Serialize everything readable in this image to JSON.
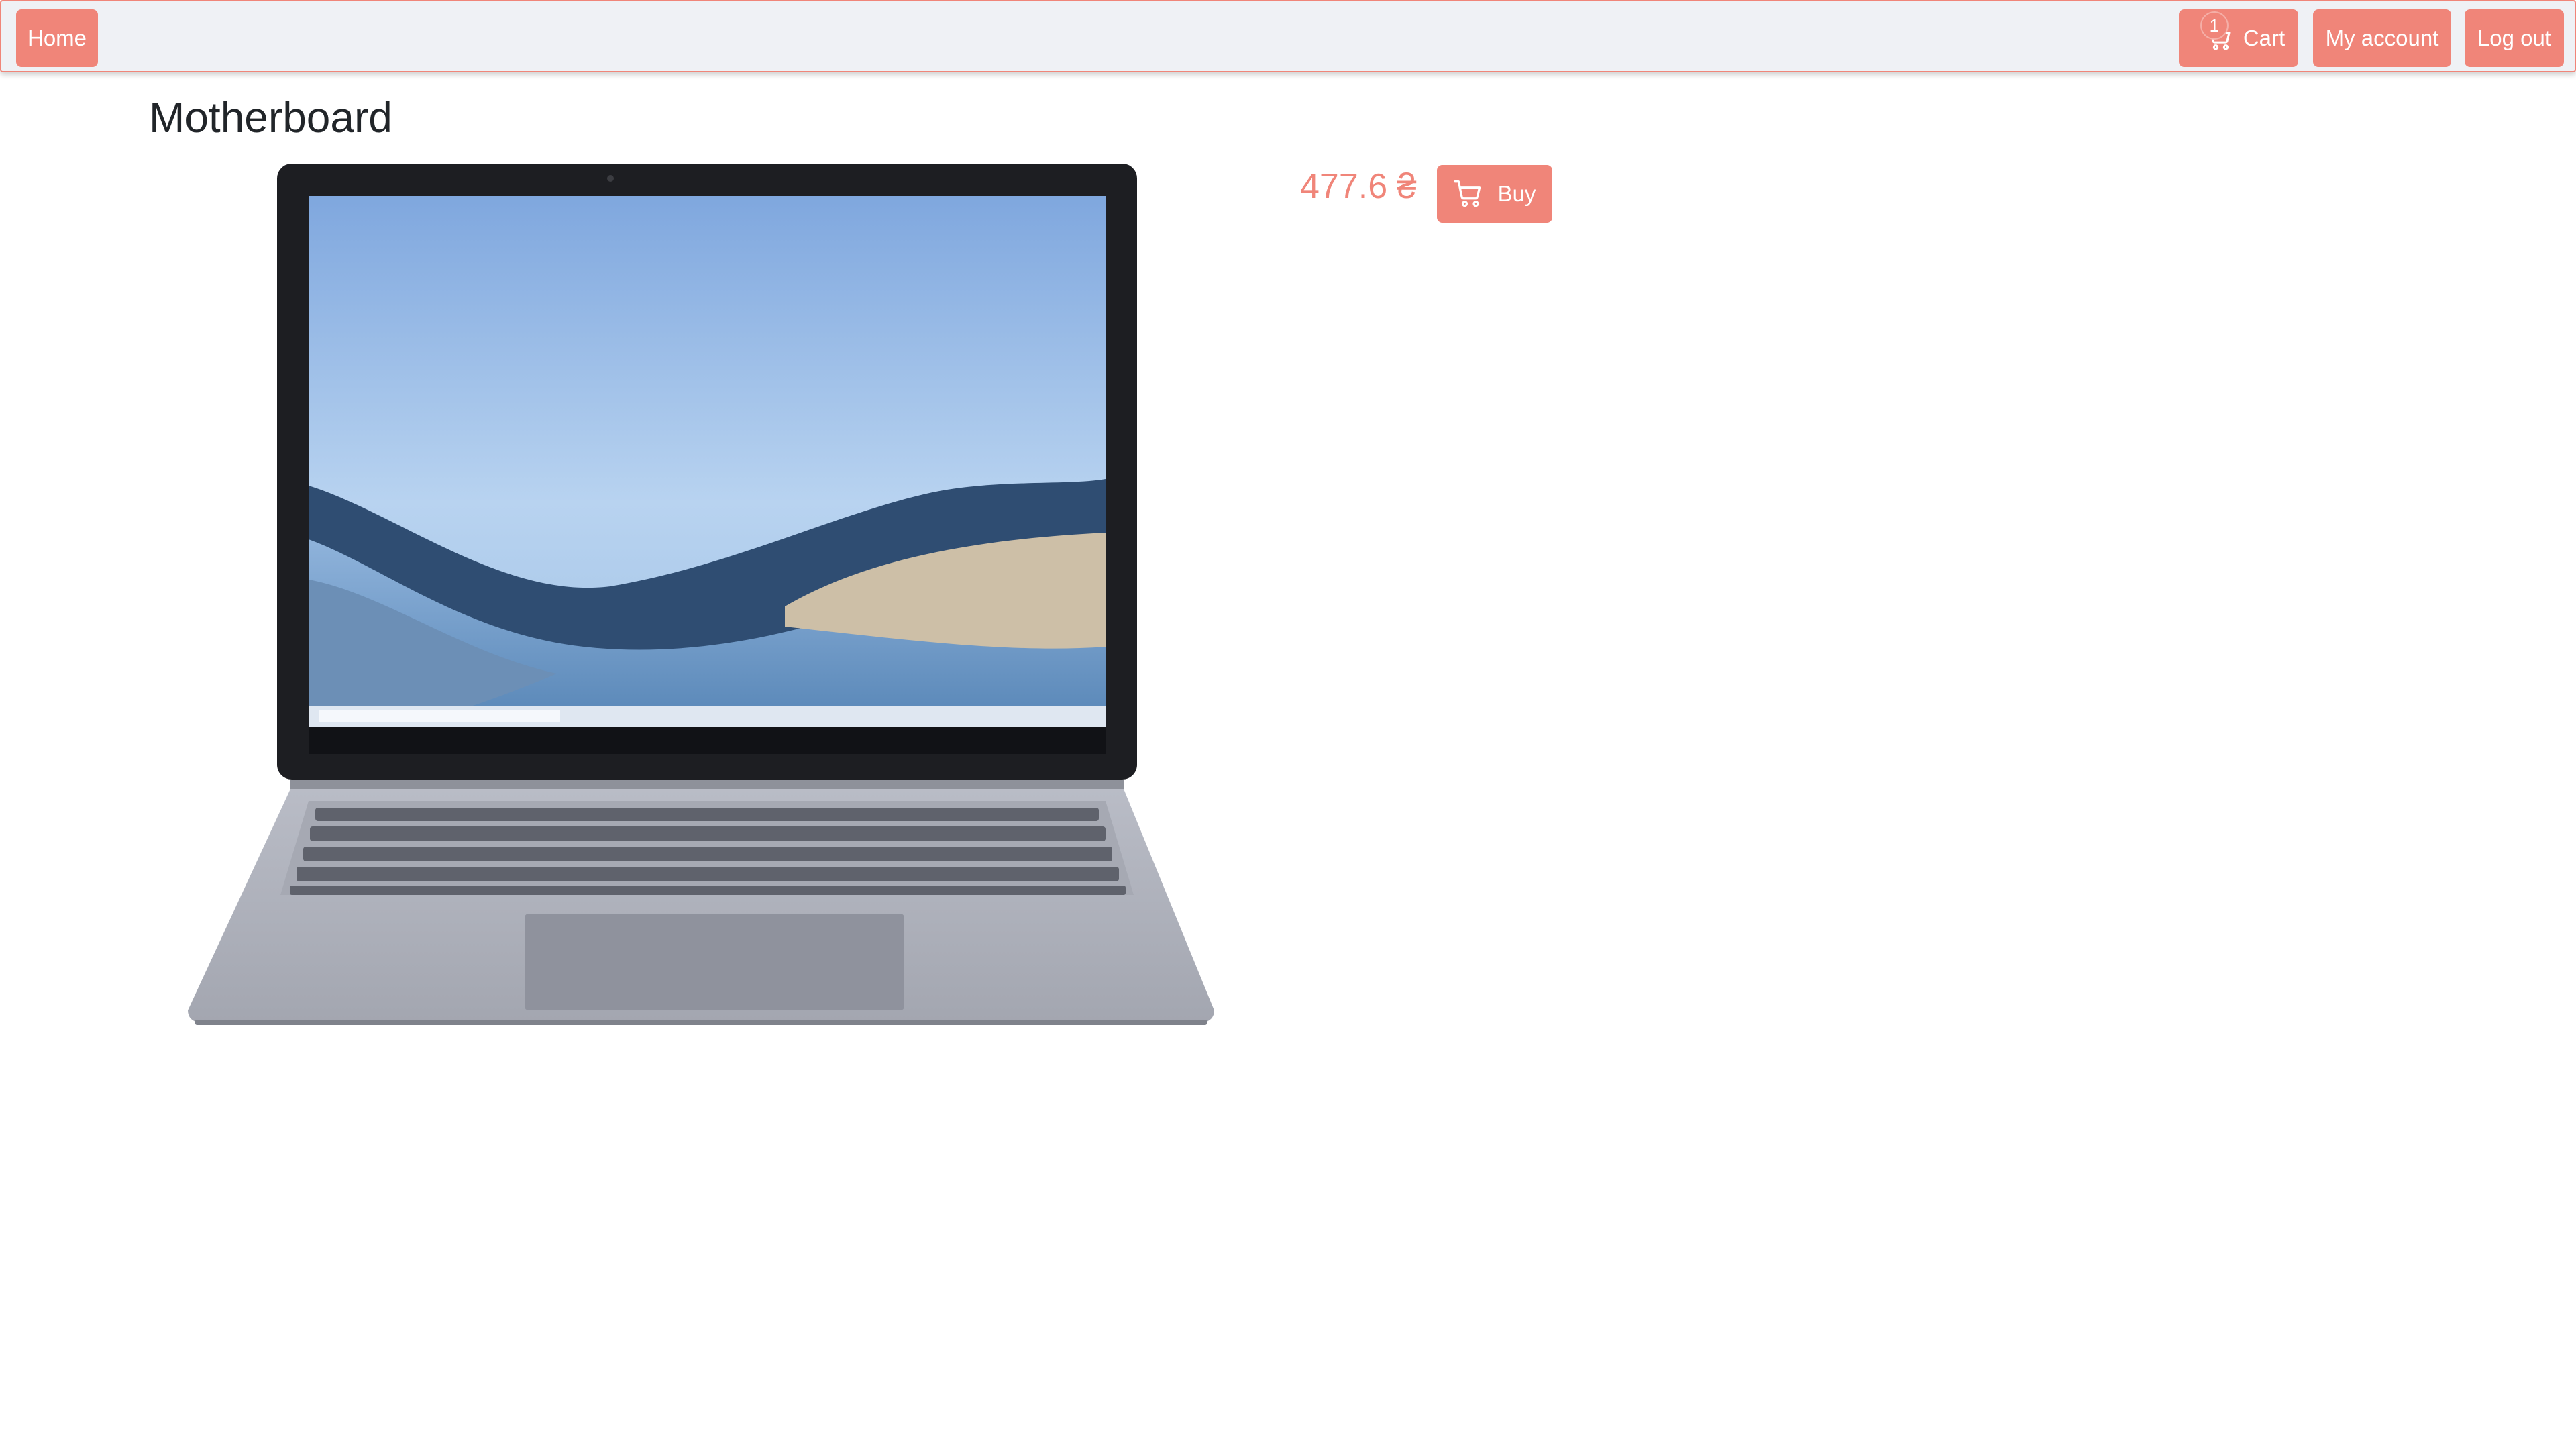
{
  "navbar": {
    "home_label": "Home",
    "cart_label": "Cart",
    "cart_count": "1",
    "account_label": "My account",
    "logout_label": "Log out"
  },
  "product": {
    "title": "Motherboard",
    "price": "477.6 ₴",
    "buy_label": "Buy",
    "image_icon": "laptop-product-image"
  },
  "colors": {
    "accent": "#f08579",
    "navbar_bg": "#eff1f5",
    "text": "#212529"
  }
}
